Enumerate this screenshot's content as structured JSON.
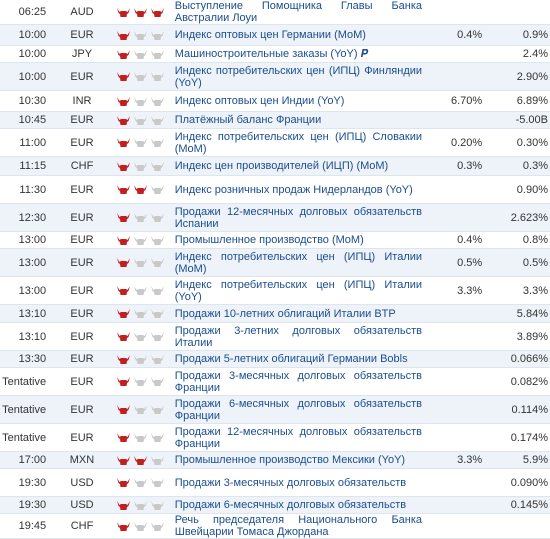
{
  "colors": {
    "bull_active": "#c41f1f",
    "bull_inactive": "#c9c9c9",
    "link": "#1a4d8f",
    "row_alt": "#eef3f9"
  },
  "importance_icon": "bull-icon",
  "rows": [
    {
      "time": "06:25",
      "currency": "AUD",
      "importance": 3,
      "event": "Выступление Помощника Главы Банка Австралии Лоуи",
      "forecast": "",
      "previous": ""
    },
    {
      "time": "10:00",
      "currency": "EUR",
      "importance": 1,
      "event": "Индекс оптовых цен Германии (MoM)",
      "forecast": "0.4%",
      "previous": "0.9%"
    },
    {
      "time": "10:00",
      "currency": "JPY",
      "importance": 1,
      "event": "Машиностроительные заказы (YoY) 𝑷",
      "forecast": "",
      "previous": "2.4%"
    },
    {
      "time": "10:00",
      "currency": "EUR",
      "importance": 1,
      "event": "Индекс потребительских цен (ИПЦ) Финляндии (YoY)",
      "forecast": "",
      "previous": "2.90%"
    },
    {
      "time": "10:30",
      "currency": "INR",
      "importance": 1,
      "event": "Индекс оптовых цен Индии (YoY)",
      "forecast": "6.70%",
      "previous": "6.89%"
    },
    {
      "time": "10:45",
      "currency": "EUR",
      "importance": 1,
      "event": "Платёжный баланс Франции",
      "forecast": "",
      "previous": "-5.00B"
    },
    {
      "time": "11:00",
      "currency": "EUR",
      "importance": 1,
      "event": "Индекс потребительских цен (ИПЦ) Словакии (MoM)",
      "forecast": "0.20%",
      "previous": "0.30%"
    },
    {
      "time": "11:15",
      "currency": "CHF",
      "importance": 1,
      "event": "Индекс цен производителей (ИЦП) (MoM)",
      "forecast": "0.3%",
      "previous": "0.3%"
    },
    {
      "time": "11:30",
      "currency": "EUR",
      "importance": 2,
      "event": "Индекс розничных продаж Нидерландов (YoY)",
      "forecast": "",
      "previous": "0.90%"
    },
    {
      "time": "12:30",
      "currency": "EUR",
      "importance": 1,
      "event": "Продажи 12-месячных долговых обязательств Испании",
      "forecast": "",
      "previous": "2.623%"
    },
    {
      "time": "13:00",
      "currency": "EUR",
      "importance": 1,
      "event": "Промышленное производство (MoM)",
      "forecast": "0.4%",
      "previous": "0.8%"
    },
    {
      "time": "13:00",
      "currency": "EUR",
      "importance": 1,
      "event": "Индекс потребительских цен (ИПЦ) Италии (MoM)",
      "forecast": "0.5%",
      "previous": "0.5%"
    },
    {
      "time": "13:00",
      "currency": "EUR",
      "importance": 1,
      "event": "Индекс потребительских цен (ИПЦ) Италии (YoY)",
      "forecast": "3.3%",
      "previous": "3.3%"
    },
    {
      "time": "13:10",
      "currency": "EUR",
      "importance": 1,
      "event": "Продажи 10-летних облигаций Италии BTP",
      "forecast": "",
      "previous": "5.84%"
    },
    {
      "time": "13:10",
      "currency": "EUR",
      "importance": 1,
      "event": "Продажи 3-летних долговых обязательств Италии",
      "forecast": "",
      "previous": "3.89%"
    },
    {
      "time": "13:30",
      "currency": "EUR",
      "importance": 1,
      "event": "Продажи 5-летних облигаций Германии Bobls",
      "forecast": "",
      "previous": "0.066%"
    },
    {
      "time": "Tentative",
      "currency": "EUR",
      "importance": 1,
      "event": "Продажи 3-месячных долговых обязательств Франции",
      "forecast": "",
      "previous": "0.082%"
    },
    {
      "time": "Tentative",
      "currency": "EUR",
      "importance": 1,
      "event": "Продажи 6-месячных долговых обязательств Франции",
      "forecast": "",
      "previous": "0.114%"
    },
    {
      "time": "Tentative",
      "currency": "EUR",
      "importance": 1,
      "event": "Продажи 12-месячных долговых обязательств Франции",
      "forecast": "",
      "previous": "0.174%"
    },
    {
      "time": "17:00",
      "currency": "MXN",
      "importance": 2,
      "event": "Промышленное производство Мексики (YoY)",
      "forecast": "3.3%",
      "previous": "5.9%"
    },
    {
      "time": "19:30",
      "currency": "USD",
      "importance": 1,
      "event": "Продажи 3-месячных долговых обязательств",
      "forecast": "",
      "previous": "0.090%"
    },
    {
      "time": "19:30",
      "currency": "USD",
      "importance": 1,
      "event": "Продажи 6-месячных долговых обязательств",
      "forecast": "",
      "previous": "0.145%"
    },
    {
      "time": "19:45",
      "currency": "CHF",
      "importance": 1,
      "event": "Речь председателя Национального Банка Швейцарии Томаса Джордана",
      "forecast": "",
      "previous": ""
    }
  ]
}
